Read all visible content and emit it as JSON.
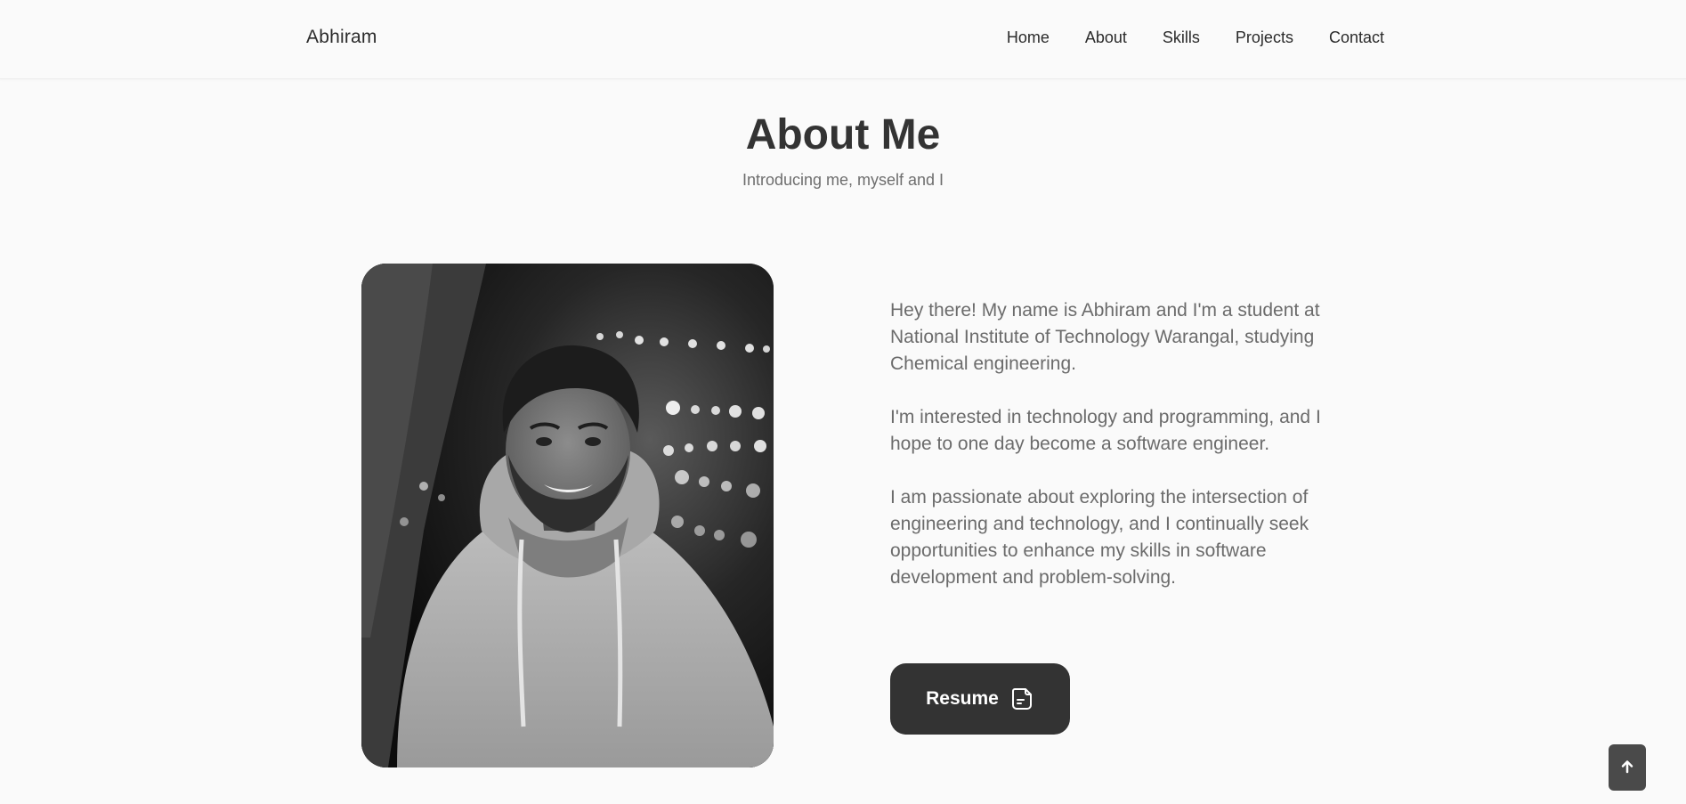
{
  "header": {
    "brand": "Abhiram",
    "nav": [
      {
        "label": "Home"
      },
      {
        "label": "About"
      },
      {
        "label": "Skills"
      },
      {
        "label": "Projects"
      },
      {
        "label": "Contact"
      }
    ]
  },
  "about": {
    "title": "About Me",
    "subtitle": "Introducing me, myself and I",
    "paragraphs": [
      "Hey there! My name is Abhiram and I'm a student at National Institute of Technology Warangal, studying Chemical engineering.",
      "I'm interested in technology and programming, and I hope to one day become a software engineer.",
      "I am passionate about exploring the intersection of engineering and technology, and I continually seek opportunities to enhance my skills in software development and problem-solving."
    ],
    "resume_label": "Resume",
    "resume_icon": "document-icon"
  },
  "scroll_top": {
    "icon": "arrow-up-icon"
  },
  "colors": {
    "background": "#fafafa",
    "text_dark": "#333333",
    "text_muted": "#6b6b6b",
    "button_bg": "#333333",
    "scroll_btn_bg": "#4a4a4a"
  }
}
